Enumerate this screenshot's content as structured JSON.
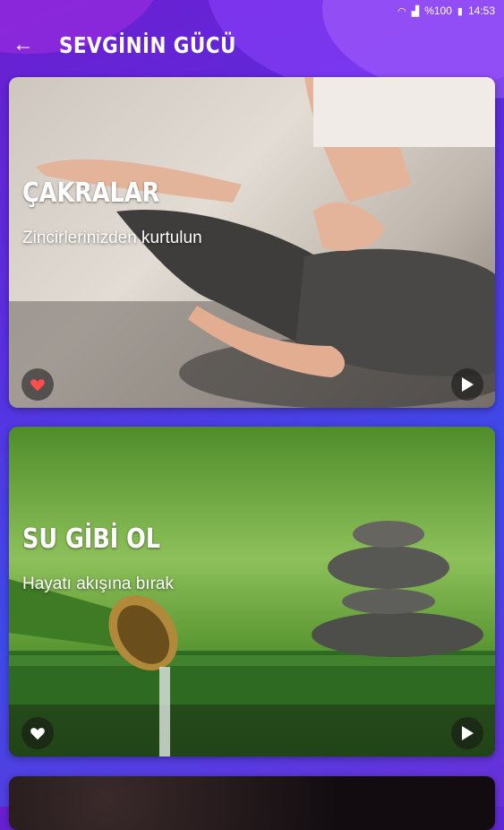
{
  "status_bar": {
    "battery": "%100",
    "time": "14:53"
  },
  "app_bar": {
    "title": "SEVGİNİN GÜCÜ"
  },
  "cards": [
    {
      "title": "ÇAKRALAR",
      "subtitle": "Zincirlerinizden kurtulun",
      "favorite": true,
      "favorite_color": "#ff4d4d"
    },
    {
      "title": "SU GİBİ OL",
      "subtitle": "Hayatı akışına bırak",
      "favorite": false,
      "favorite_color": "#ffffff"
    }
  ],
  "icons": [
    "arrow-back-icon",
    "heart-icon",
    "play-icon",
    "wifi-icon",
    "signal-icon",
    "battery-icon"
  ]
}
